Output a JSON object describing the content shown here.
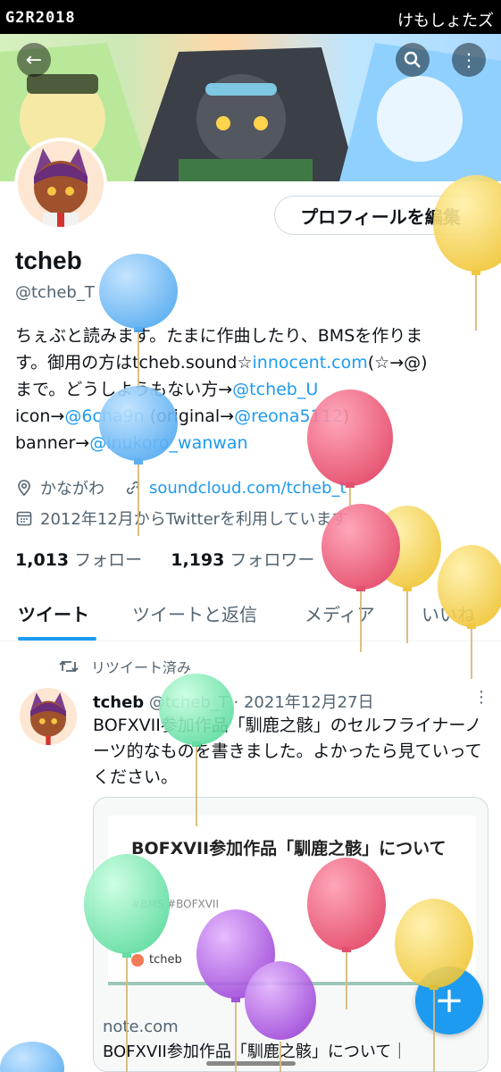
{
  "statusbar": {
    "left": "G2R2018",
    "right": "けもしょたズ"
  },
  "header": {
    "back_icon": "arrow-left-icon",
    "search_icon": "search-icon",
    "more_icon": "more-vertical-icon"
  },
  "profile": {
    "edit_button": "プロフィールを編集",
    "name": "tcheb",
    "handle": "@tcheb_T",
    "bio": {
      "line1": "ちぇぶと読みます。たまに作曲したり、BMSを作りま",
      "line2_a": "す。御用の方はtcheb.sound☆",
      "line2_link": "innocent.com",
      "line2_b": "(☆→@)",
      "line3_a": "まで。どうしようもない方→",
      "line3_link": "@tcheb_U",
      "line4_a": "icon→",
      "line4_link1": "@6cha9n",
      "line4_b": " (original→",
      "line4_link2": "@reona5112",
      "line4_c": ")",
      "line5_a": "banner→",
      "line5_link": "@inukoro_wanwan"
    },
    "location": "かながわ",
    "website": "soundcloud.com/tcheb_t",
    "joined": "2012年12月からTwitterを利用しています",
    "following_count": "1,013",
    "following_label": "フォロー",
    "followers_count": "1,193",
    "followers_label": "フォロワー"
  },
  "tabs": [
    {
      "label": "ツイート"
    },
    {
      "label": "ツイートと返信"
    },
    {
      "label": "メディア"
    },
    {
      "label": "いいね"
    }
  ],
  "tweet": {
    "retweet_label": "リツイート済み",
    "author_name": "tcheb",
    "author_handle": "@tcheb_T",
    "date": "· 2021年12月27日",
    "text": "BOFXVII参加作品「馴鹿之骸」のセルフライナーノーツ的なものを書きました。よかったら見ていってください。",
    "card": {
      "title": "BOFXVII参加作品「馴鹿之骸」について",
      "tags": "#BMS   #BOFXVII",
      "author": "tcheb",
      "domain": "note.com",
      "description": "BOFXVII参加作品「馴鹿之骸」について｜"
    }
  },
  "fab_label": "+",
  "colors": {
    "accent": "#1d9bf0",
    "text": "#0f1419",
    "muted": "#536471"
  }
}
